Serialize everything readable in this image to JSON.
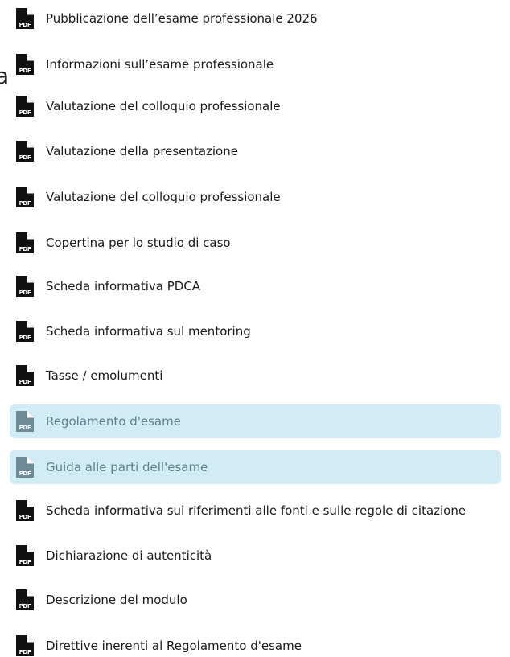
{
  "colors": {
    "background": "#ffffff",
    "text": "#1a1a1a",
    "highlight_background": "#d2ecf6",
    "highlight_text": "#5f7f8c",
    "icon_dark": "#111111",
    "icon_muted": "#6d8a96"
  },
  "edge_fragment": "a",
  "icon_text": "PDF",
  "documents": [
    {
      "label": "Pubblicazione dell’esame professionale 2026",
      "icon": "pdf-file-icon",
      "highlighted": false
    },
    {
      "label": "Informazioni sull’esame professionale",
      "icon": "pdf-file-icon",
      "highlighted": false
    },
    {
      "label": "Valutazione del colloquio professionale",
      "icon": "pdf-file-icon",
      "highlighted": false
    },
    {
      "label": "Valutazione della presentazione",
      "icon": "pdf-file-icon",
      "highlighted": false
    },
    {
      "label": "Valutazione del colloquio professionale",
      "icon": "pdf-file-icon",
      "highlighted": false
    },
    {
      "label": "Copertina per lo studio di caso",
      "icon": "pdf-file-icon",
      "highlighted": false
    },
    {
      "label": "Scheda informativa PDCA",
      "icon": "pdf-file-icon",
      "highlighted": false
    },
    {
      "label": "Scheda informativa sul mentoring",
      "icon": "pdf-file-icon",
      "highlighted": false
    },
    {
      "label": "Tasse / emolumenti",
      "icon": "pdf-file-icon",
      "highlighted": false
    },
    {
      "label": "Regolamento d'esame",
      "icon": "pdf-file-icon",
      "highlighted": true
    },
    {
      "label": "Guida alle parti dell'esame",
      "icon": "pdf-file-icon",
      "highlighted": true
    },
    {
      "label": "Scheda informativa sui riferimenti alle fonti e sulle regole di citazione",
      "icon": "pdf-file-icon",
      "highlighted": false
    },
    {
      "label": "Dichiarazione di autenticità",
      "icon": "pdf-file-icon",
      "highlighted": false
    },
    {
      "label": "Descrizione del modulo",
      "icon": "pdf-file-icon",
      "highlighted": false
    },
    {
      "label": "Direttive inerenti al Regolamento d'esame",
      "icon": "pdf-file-icon",
      "highlighted": false
    }
  ]
}
